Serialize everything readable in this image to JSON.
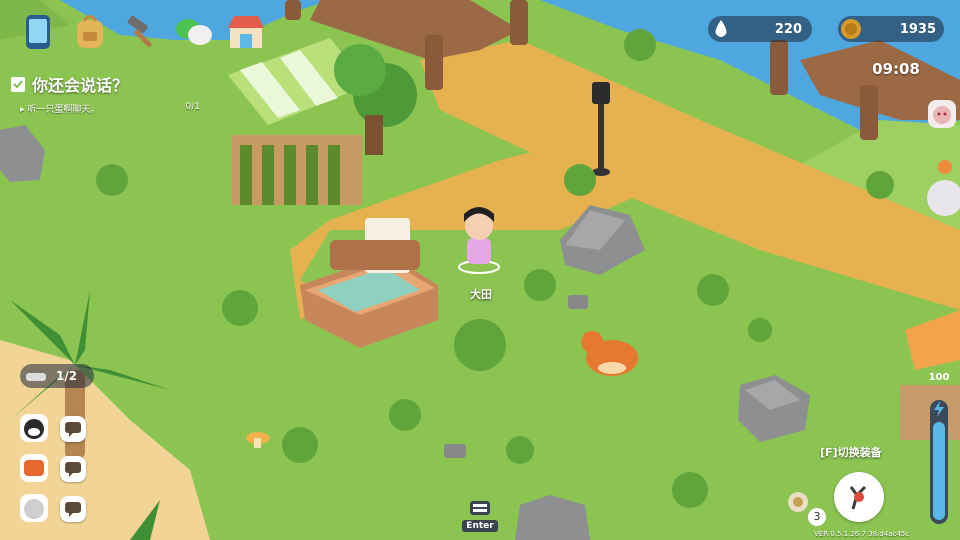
{
  "currency": {
    "water": "220",
    "coins": "1935"
  },
  "clock": "09:08",
  "quest": {
    "title": "你还会说话？",
    "subtitle": "▸ 听一只蛋啊聊天。",
    "progress": "0/1"
  },
  "player": {
    "name": "大田"
  },
  "pets_counter": "1/2",
  "enter_key": "Enter",
  "equip_hint": "[F]切换装备",
  "item_count": "3",
  "version": "VER 0.5.1.26.7 38.d4ac45c",
  "energy_level": "100",
  "top_icons": [
    "phone-icon",
    "backpack-icon",
    "hammer-icon",
    "chat-bubbles-icon",
    "shop-icon"
  ],
  "colors": {
    "grass": "#8cc452",
    "path": "#e6b24f",
    "water": "#4fa7e0",
    "hud_pill": "#34404f",
    "energy": "#5ab8e8"
  }
}
